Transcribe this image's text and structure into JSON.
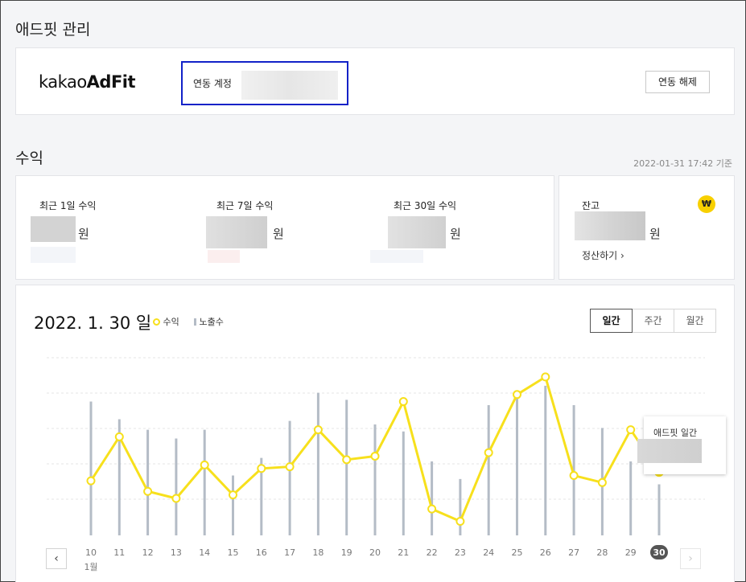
{
  "page_title": "애드핏 관리",
  "account": {
    "logo_light": "kakao",
    "logo_bold": "AdFit",
    "linked_label": "연동 계정",
    "unlink_label": "연동 해제"
  },
  "revenue": {
    "section_title": "수익",
    "as_of": "2022-01-31 17:42 기준",
    "stats": [
      {
        "label": "최근 1일 수익",
        "unit": "원"
      },
      {
        "label": "최근 7일 수익",
        "unit": "원"
      },
      {
        "label": "최근 30일 수익",
        "unit": "원"
      }
    ],
    "balance": {
      "label": "잔고",
      "unit": "원",
      "settle_label": "정산하기 ›",
      "icon": "won-icon",
      "icon_glyph": "₩"
    }
  },
  "chart": {
    "date_label": "2022. 1. 30 일",
    "legend_revenue": "수익",
    "legend_impressions": "노출수",
    "tabs": [
      "일간",
      "주간",
      "월간"
    ],
    "prev_label": "‹",
    "next_label": "›",
    "tooltip_title": "애드핏 일간",
    "month_label": "1월"
  },
  "colors": {
    "revenue": "#f7e01c",
    "impressions": "#b4bcc6",
    "highlight": "#1222c8"
  },
  "chart_data": {
    "type": "line",
    "categories": [
      "10",
      "11",
      "12",
      "13",
      "14",
      "15",
      "16",
      "17",
      "18",
      "19",
      "20",
      "21",
      "22",
      "23",
      "24",
      "25",
      "26",
      "27",
      "28",
      "29",
      "30"
    ],
    "selected": "30",
    "series": [
      {
        "name": "수익",
        "type": "line",
        "values": [
          31,
          56,
          25,
          21,
          40,
          23,
          38,
          39,
          60,
          43,
          45,
          76,
          15,
          8,
          47,
          80,
          90,
          34,
          30,
          60,
          36
        ]
      },
      {
        "name": "노출수",
        "type": "bar",
        "values": [
          76,
          66,
          60,
          55,
          60,
          34,
          44,
          65,
          81,
          77,
          63,
          59,
          42,
          32,
          74,
          80,
          85,
          74,
          61,
          42,
          29
        ]
      }
    ],
    "ylim": [
      0,
      100
    ],
    "grid": true
  }
}
